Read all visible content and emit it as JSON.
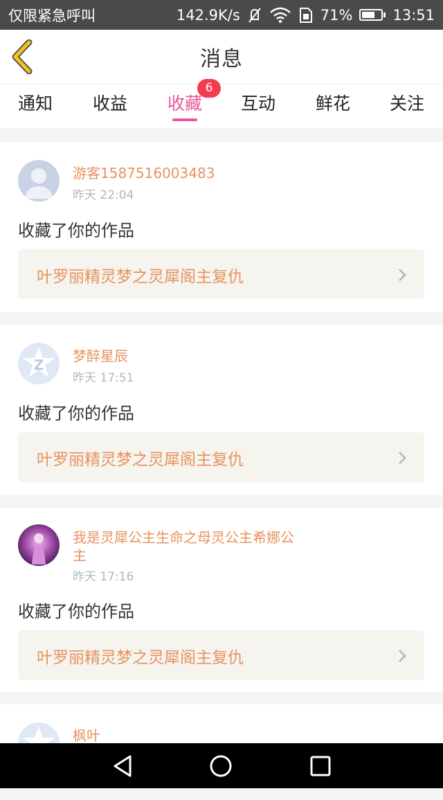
{
  "status_bar": {
    "left_text": "仅限紧急呼叫",
    "speed": "142.9K/s",
    "battery": "71%",
    "battery_level": 0.71,
    "time": "13:51"
  },
  "header": {
    "title": "消息"
  },
  "tabs": [
    {
      "label": "通知"
    },
    {
      "label": "收益"
    },
    {
      "label": "收藏",
      "active": true,
      "badge": "6"
    },
    {
      "label": "互动"
    },
    {
      "label": "鲜花"
    },
    {
      "label": "关注"
    }
  ],
  "feed": [
    {
      "user": "游客1587516003483",
      "time": "昨天 22:04",
      "action": "收藏了你的作品",
      "work": "叶罗丽精灵梦之灵犀阁主复仇",
      "avatar": "default-avatar"
    },
    {
      "user": "梦醉星辰",
      "time": "昨天 17:51",
      "action": "收藏了你的作品",
      "work": "叶罗丽精灵梦之灵犀阁主复仇",
      "avatar": "qq-avatar"
    },
    {
      "user": "我是灵犀公主生命之母灵公主希娜公主",
      "time": "昨天 17:16",
      "action": "收藏了你的作品",
      "work": "叶罗丽精灵梦之灵犀阁主复仇",
      "avatar": "photo-avatar"
    },
    {
      "user": "枫叶",
      "avatar": "qq-avatar"
    }
  ],
  "colors": {
    "accent": "#e8579a",
    "username": "#e8925e",
    "badge": "#f23d4f",
    "back_arrow": "#f6c31c"
  }
}
